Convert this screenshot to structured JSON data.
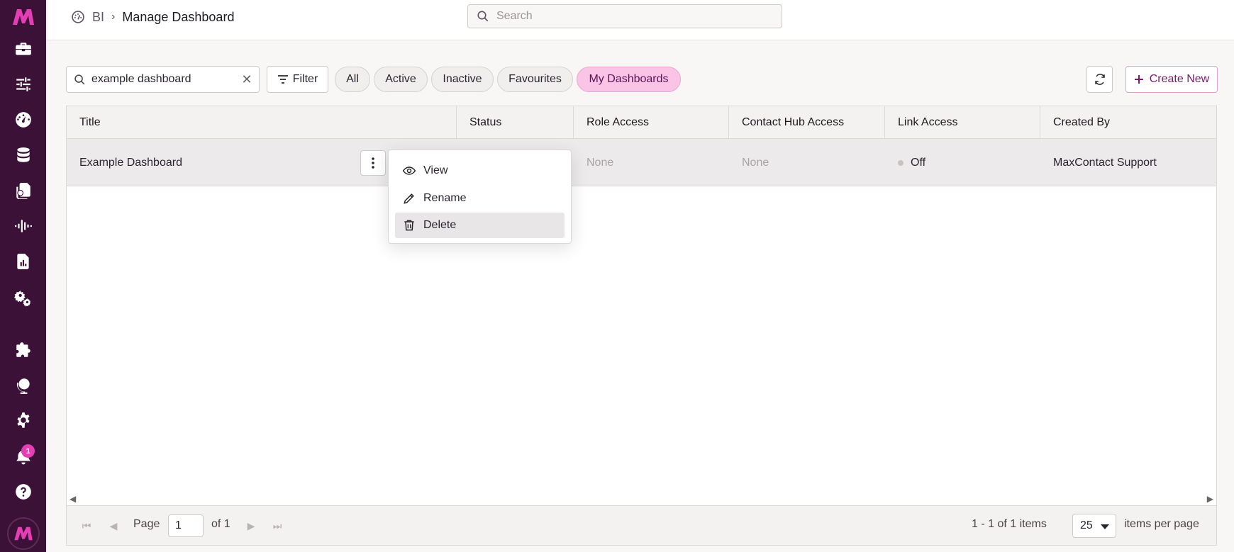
{
  "sidebar": {
    "logo": "M",
    "items": [
      {
        "icon": "toolbox-icon"
      },
      {
        "icon": "sliders-icon"
      },
      {
        "icon": "dashboard-gauge-icon"
      },
      {
        "icon": "database-icon"
      },
      {
        "icon": "documents-icon"
      },
      {
        "icon": "audio-wave-icon"
      },
      {
        "icon": "report-file-icon"
      },
      {
        "icon": "gears-icon"
      },
      {
        "icon": "puzzle-icon"
      },
      {
        "icon": "globe-icon"
      },
      {
        "icon": "settings-icon"
      },
      {
        "icon": "bell-icon",
        "badge": "1"
      },
      {
        "icon": "help-icon"
      }
    ]
  },
  "breadcrumb": {
    "section": "BI",
    "separator": "›",
    "page": "Manage Dashboard"
  },
  "top_search": {
    "placeholder": "Search"
  },
  "toolbar": {
    "search_value": "example dashboard",
    "filter_label": "Filter",
    "chips": [
      "All",
      "Active",
      "Inactive",
      "Favourites",
      "My Dashboards"
    ],
    "active_chip": "My Dashboards",
    "create_label": "Create New"
  },
  "grid": {
    "columns": [
      "Title",
      "Status",
      "Role Access",
      "Contact Hub Access",
      "Link Access",
      "Created By"
    ],
    "rows": [
      {
        "title": "Example Dashboard",
        "status": "",
        "role_access": "None",
        "contact_hub_access": "None",
        "link_access": "Off",
        "created_by": "MaxContact Support"
      }
    ]
  },
  "context_menu": {
    "items": [
      "View",
      "Rename",
      "Delete"
    ],
    "highlighted": "Delete"
  },
  "pager": {
    "page_label": "Page",
    "page_value": "1",
    "of_label": "of 1",
    "range_label": "1 - 1 of 1 items",
    "page_size": "25",
    "per_page_label": "items per page"
  },
  "colors": {
    "sidebar_bg": "#3b1138",
    "accent": "#e53eb5",
    "chip_active_bg": "#f9c4e6",
    "create_text": "#7b1c6c"
  }
}
